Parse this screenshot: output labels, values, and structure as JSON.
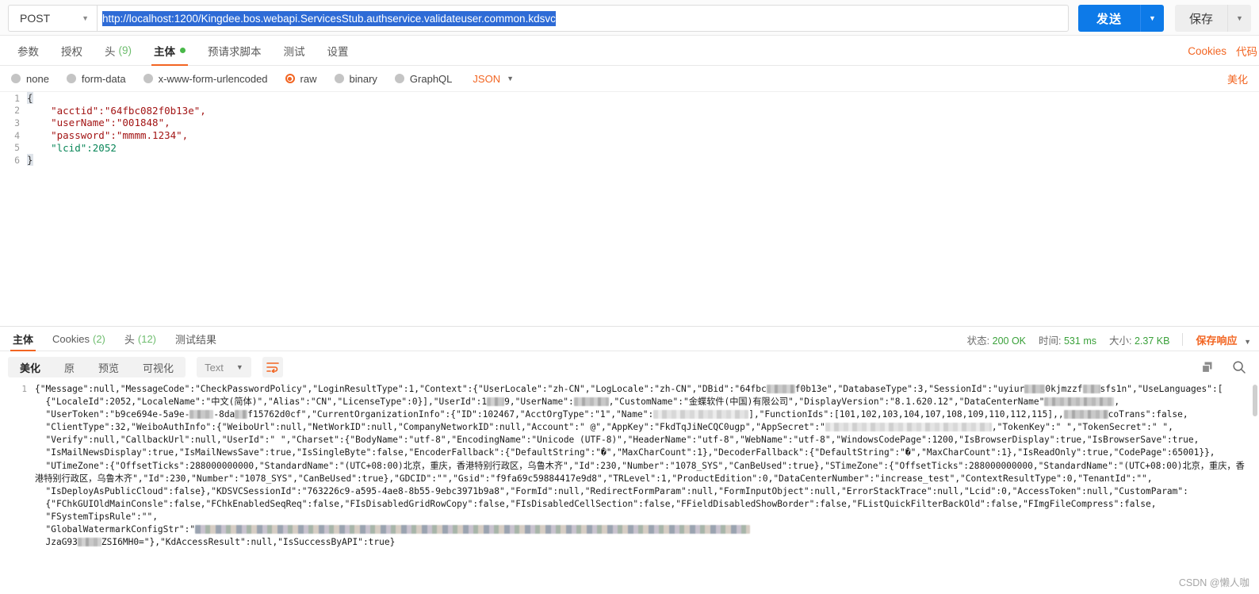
{
  "urlbar": {
    "method": "POST",
    "url": "http://localhost:1200/Kingdee.bos.webapi.ServicesStub.authservice.validateuser.common.kdsvc",
    "send_label": "发送",
    "save_label": "保存"
  },
  "request_tabs": {
    "items": [
      {
        "label": "参数",
        "count": "",
        "active": false,
        "dot": false
      },
      {
        "label": "授权",
        "count": "",
        "active": false,
        "dot": false
      },
      {
        "label": "头",
        "count": "(9)",
        "active": false,
        "dot": false
      },
      {
        "label": "主体",
        "count": "",
        "active": true,
        "dot": true
      },
      {
        "label": "预请求脚本",
        "count": "",
        "active": false,
        "dot": false
      },
      {
        "label": "测试",
        "count": "",
        "active": false,
        "dot": false
      },
      {
        "label": "设置",
        "count": "",
        "active": false,
        "dot": false
      }
    ],
    "right_links": [
      "Cookies",
      "代码"
    ]
  },
  "body_type": {
    "options": [
      {
        "label": "none",
        "selected": false
      },
      {
        "label": "form-data",
        "selected": false
      },
      {
        "label": "x-www-form-urlencoded",
        "selected": false
      },
      {
        "label": "raw",
        "selected": true
      },
      {
        "label": "binary",
        "selected": false
      },
      {
        "label": "GraphQL",
        "selected": false
      }
    ],
    "format": "JSON",
    "beautify_label": "美化"
  },
  "editor": {
    "lines": [
      {
        "no": "1",
        "text": "{"
      },
      {
        "no": "2",
        "text": "    \"acctid\":\"64fbc082f0b13e\","
      },
      {
        "no": "3",
        "text": "    \"userName\":\"001848\","
      },
      {
        "no": "4",
        "text": "    \"password\":\"mmmm.1234\","
      },
      {
        "no": "5",
        "text": "    \"lcid\":2052"
      },
      {
        "no": "6",
        "text": "}"
      }
    ]
  },
  "response_tabs": {
    "items": [
      {
        "label": "主体",
        "count": "",
        "active": true
      },
      {
        "label": "Cookies",
        "count": "(2)",
        "active": false
      },
      {
        "label": "头",
        "count": "(12)",
        "active": false
      },
      {
        "label": "测试结果",
        "count": "",
        "active": false
      }
    ],
    "status_label": "状态:",
    "status_value": "200 OK",
    "time_label": "时间:",
    "time_value": "531 ms",
    "size_label": "大小:",
    "size_value": "2.37 KB",
    "save_response": "保存响应"
  },
  "response_toolbar": {
    "views": [
      {
        "label": "美化",
        "active": true
      },
      {
        "label": "原",
        "active": false
      },
      {
        "label": "预览",
        "active": false
      },
      {
        "label": "可视化",
        "active": false
      }
    ],
    "format": "Text",
    "icons": [
      "wrap-text-icon",
      "copy-icon",
      "search-icon"
    ]
  },
  "response_body": {
    "line_number": "1",
    "segments": [
      {
        "t": "{\"Message\":null,\"MessageCode\":\"CheckPasswordPolicy\",\"LoginResultType\":1,\"Context\":{\"UserLocale\":\"zh-CN\",\"LogLocale\":\"zh-CN\",\"DBid\":\"64fbc"
      },
      {
        "r": 36
      },
      {
        "t": "f0b13e\",\"DatabaseType\":3,\"SessionId\":\"uyiur"
      },
      {
        "r": 26
      },
      {
        "t": "0kjmzzf"
      },
      {
        "r": 22
      },
      {
        "t": "sfs1n\",\"UseLanguages\":[\n  {\"LocaleId\":2052,\"LocaleName\":\"中文(简体)\",\"Alias\":\"CN\",\"LicenseType\":0}],\"UserId\":1"
      },
      {
        "r": 22
      },
      {
        "t": "9,\"UserName\":"
      },
      {
        "r": 44
      },
      {
        "t": ",\"CustomName\":\"金蝶软件(中国)有限公司\",\"DisplayVersion\":\"8.1.620.12\",\"DataCenterName\""
      },
      {
        "r": 88
      },
      {
        "t": ",\n  \"UserToken\":\"b9ce694e-5a9e-"
      },
      {
        "r": 30
      },
      {
        "t": "-8da"
      },
      {
        "r": 16
      },
      {
        "t": "f15762d0cf\",\"CurrentOrganizationInfo\":{\"ID\":102467,\"AcctOrgType\":\"1\",\"Name\":"
      },
      {
        "r": 120
      },
      {
        "t": "],\"FunctionIds\":[101,102,103,104,107,108,109,110,112,115],,"
      },
      {
        "r": 56
      },
      {
        "t": "coTrans\":false,\n  \"ClientType\":32,\"WeiboAuthInfo\":{\"WeiboUrl\":null,\"NetWorkID\":null,\"CompanyNetworkID\":null,\"Account\":\" @\",\"AppKey\":\"FkdTqJiNeCQC0ugp\",\"AppSecret\":\""
      },
      {
        "r": 210
      },
      {
        "t": ",\"TokenKey\":\" \",\"TokenSecret\":\" \",\n  \"Verify\":null,\"CallbackUrl\":null,\"UserId\":\" \",\"Charset\":{\"BodyName\":\"utf-8\",\"EncodingName\":\"Unicode (UTF-8)\",\"HeaderName\":\"utf-8\",\"WebName\":\"utf-8\",\"WindowsCodePage\":1200,\"IsBrowserDisplay\":true,\"IsBrowserSave\":true,\n  \"IsMailNewsDisplay\":true,\"IsMailNewsSave\":true,\"IsSingleByte\":false,\"EncoderFallback\":{\"DefaultString\":\"�\",\"MaxCharCount\":1},\"DecoderFallback\":{\"DefaultString\":\"�\",\"MaxCharCount\":1},\"IsReadOnly\":true,\"CodePage\":65001}},\n  \"UTimeZone\":{\"OffsetTicks\":288000000000,\"StandardName\":\"(UTC+08:00)北京，重庆，香港特别行政区，乌鲁木齐\",\"Id\":230,\"Number\":\"1078_SYS\",\"CanBeUsed\":true},\"STimeZone\":{\"OffsetTicks\":288000000000,\"StandardName\":\"(UTC+08:00)北京，重庆，香港特别行政区，乌鲁木齐\",\"Id\":230,\"Number\":\"1078_SYS\",\"CanBeUsed\":true},\"GDCID\":\"\",\"Gsid\":\"f9fa69c59884417e9d8\",\"TRLevel\":1,\"ProductEdition\":0,\"DataCenterNumber\":\"increase_test\",\"ContextResultType\":0,\"TenantId\":\"\",\n  \"IsDeployAsPublicCloud\":false},\"KDSVCSessionId\":\"763226c9-a595-4ae8-8b55-9ebc3971b9a8\",\"FormId\":null,\"RedirectFormParam\":null,\"FormInputObject\":null,\"ErrorStackTrace\":null,\"Lcid\":0,\"AccessToken\":null,\"CustomParam\":\n  {\"FChkGUIOldMainConsle\":false,\"FChkEnabledSeqReq\":false,\"FIsDisabledGridRowCopy\":false,\"FIsDisabledCellSection\":false,\"FFieldDisabledShowBorder\":false,\"FListQuickFilterBackOld\":false,\"FImgFileCompress\":false,\n  \"FSystemTipsRule\":\"\",\n  \"GlobalWatermarkConfigStr\":\""
      },
      {
        "r": 700
      },
      {
        "t": "\n  JzaG93"
      },
      {
        "r": 30
      },
      {
        "t": "ZSI6MH0=\"},\"KdAccessResult\":null,\"IsSuccessByAPI\":true}"
      }
    ]
  },
  "watermark": "CSDN @懒人咖"
}
